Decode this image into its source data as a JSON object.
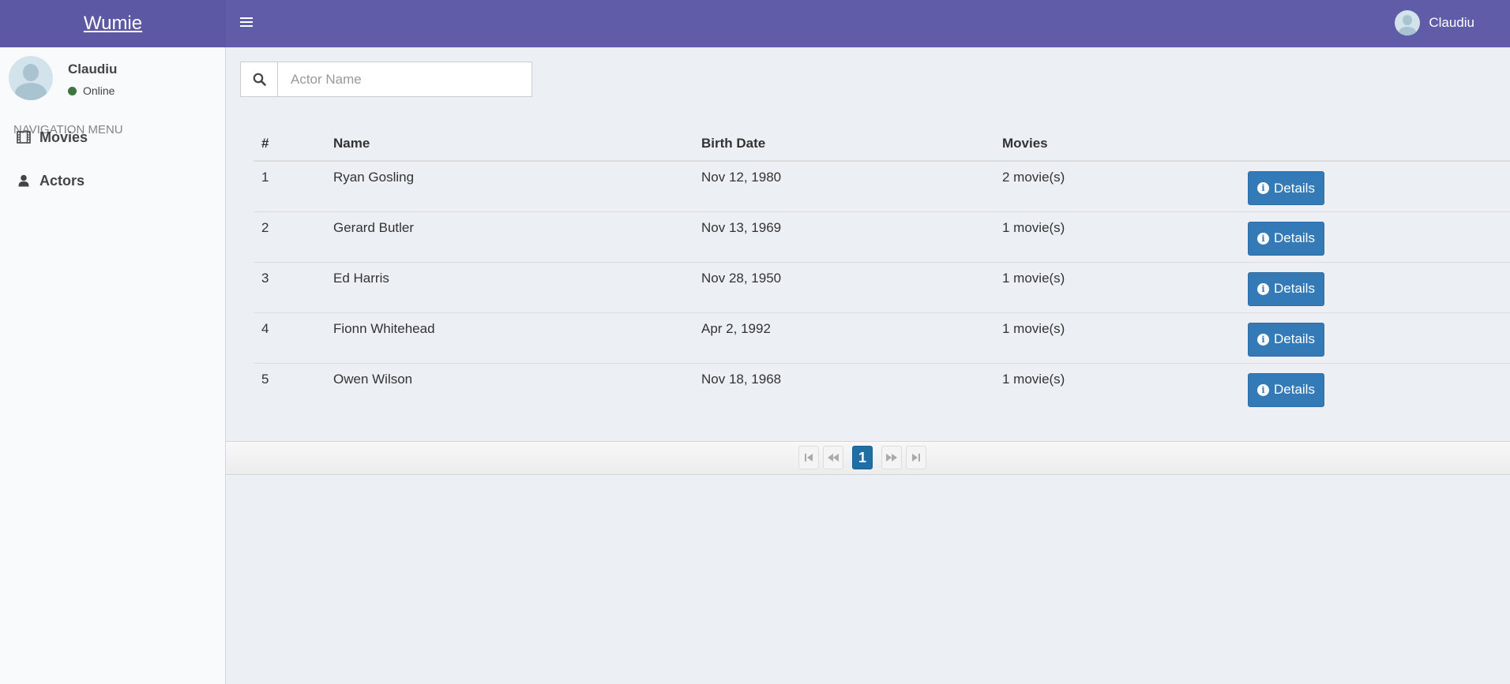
{
  "header": {
    "logo": "Wumie",
    "user_name": "Claudiu"
  },
  "sidebar": {
    "user_name": "Claudiu",
    "status": "Online",
    "nav_header": "NAVIGATION MENU",
    "items": [
      {
        "label": "Movies",
        "icon": "film-icon"
      },
      {
        "label": "Actors",
        "icon": "user-icon"
      }
    ]
  },
  "search": {
    "placeholder": "Actor Name",
    "value": ""
  },
  "table": {
    "headers": [
      "#",
      "Name",
      "Birth Date",
      "Movies",
      ""
    ],
    "button_label": "Details",
    "rows": [
      {
        "num": "1",
        "name": "Ryan Gosling",
        "birth": "Nov 12, 1980",
        "movies": "2 movie(s)"
      },
      {
        "num": "2",
        "name": "Gerard Butler",
        "birth": "Nov 13, 1969",
        "movies": "1 movie(s)"
      },
      {
        "num": "3",
        "name": "Ed Harris",
        "birth": "Nov 28, 1950",
        "movies": "1 movie(s)"
      },
      {
        "num": "4",
        "name": "Fionn Whitehead",
        "birth": "Apr 2, 1992",
        "movies": "1 movie(s)"
      },
      {
        "num": "5",
        "name": "Owen Wilson",
        "birth": "Nov 18, 1968",
        "movies": "1 movie(s)"
      }
    ]
  },
  "pagination": {
    "current_page": "1"
  },
  "colors": {
    "header_bg": "#605ca8",
    "button_bg": "#337ab7",
    "active_page": "#1f6fa5",
    "online": "#3c763d"
  }
}
